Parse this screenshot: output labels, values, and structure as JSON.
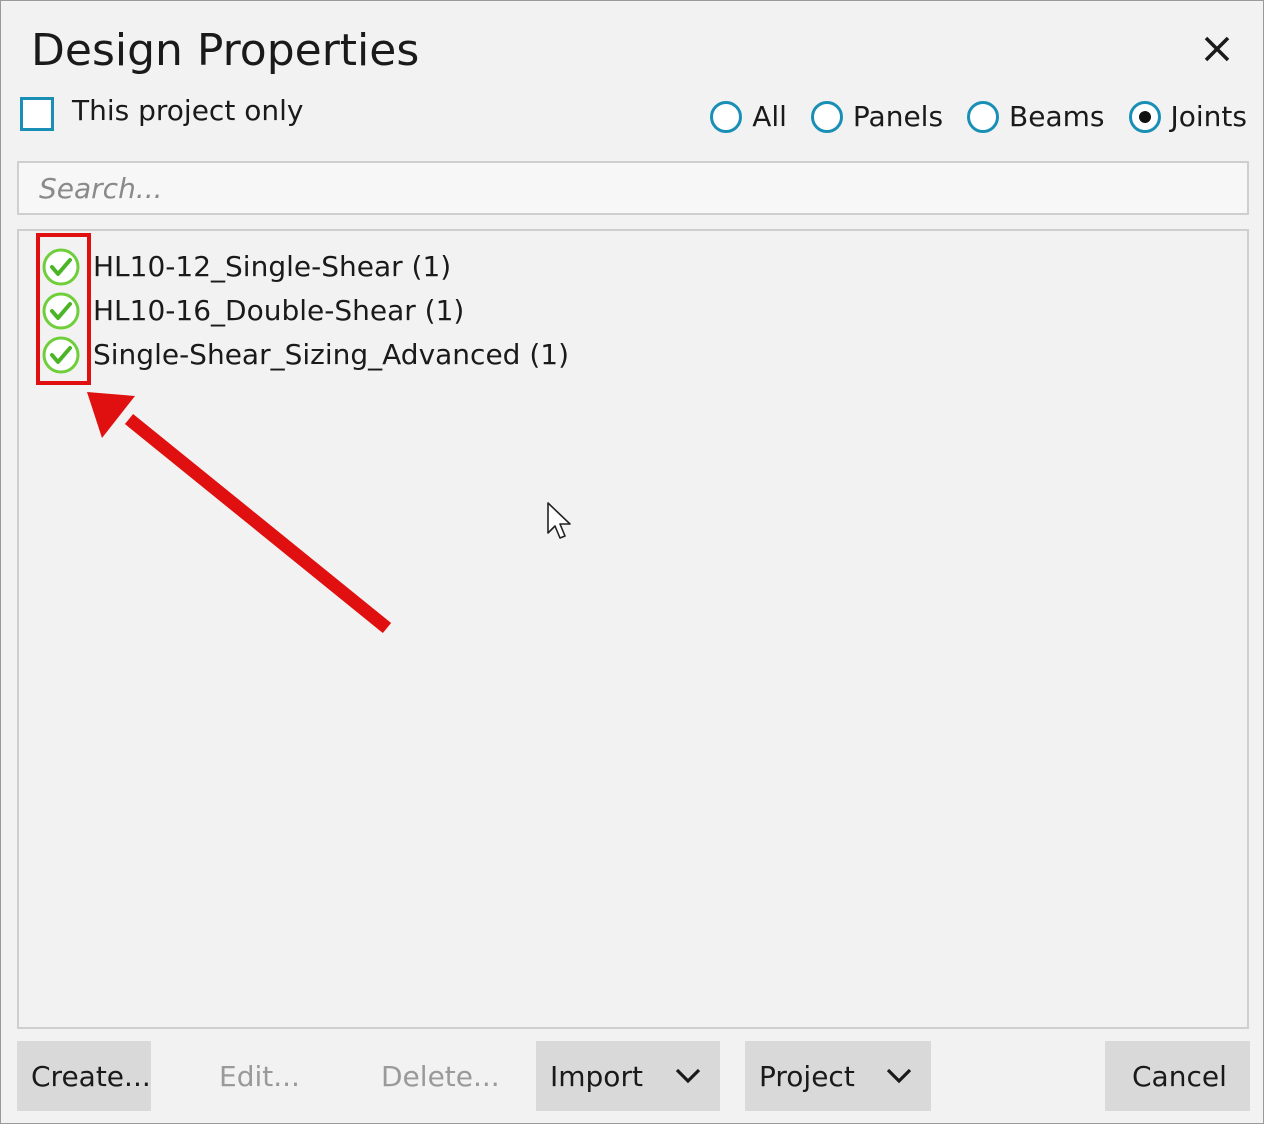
{
  "dialog": {
    "title": "Design Properties",
    "close_icon": "close-icon"
  },
  "filter": {
    "project_only_label": "This project only",
    "project_only_checked": false
  },
  "type_filter": {
    "options": [
      {
        "label": "All",
        "selected": false
      },
      {
        "label": "Panels",
        "selected": false
      },
      {
        "label": "Beams",
        "selected": false
      },
      {
        "label": "Joints",
        "selected": true
      }
    ]
  },
  "search": {
    "placeholder": "Search...",
    "value": ""
  },
  "list": {
    "items": [
      {
        "label": "HL10-12_Single-Shear (1)",
        "status_icon": "check-circle-icon"
      },
      {
        "label": "HL10-16_Double-Shear (1)",
        "status_icon": "check-circle-icon"
      },
      {
        "label": "Single-Shear_Sizing_Advanced (1)",
        "status_icon": "check-circle-icon"
      }
    ]
  },
  "footer": {
    "create_label": "Create...",
    "edit_label": "Edit...",
    "delete_label": "Delete...",
    "import_label": "Import",
    "project_label": "Project",
    "cancel_label": "Cancel"
  },
  "colors": {
    "accent": "#1a8fb5",
    "check_green": "#6fcf3a",
    "annotation_red": "#e01010",
    "button_bg": "#d9d9d9",
    "dialog_bg": "#f2f2f2"
  }
}
